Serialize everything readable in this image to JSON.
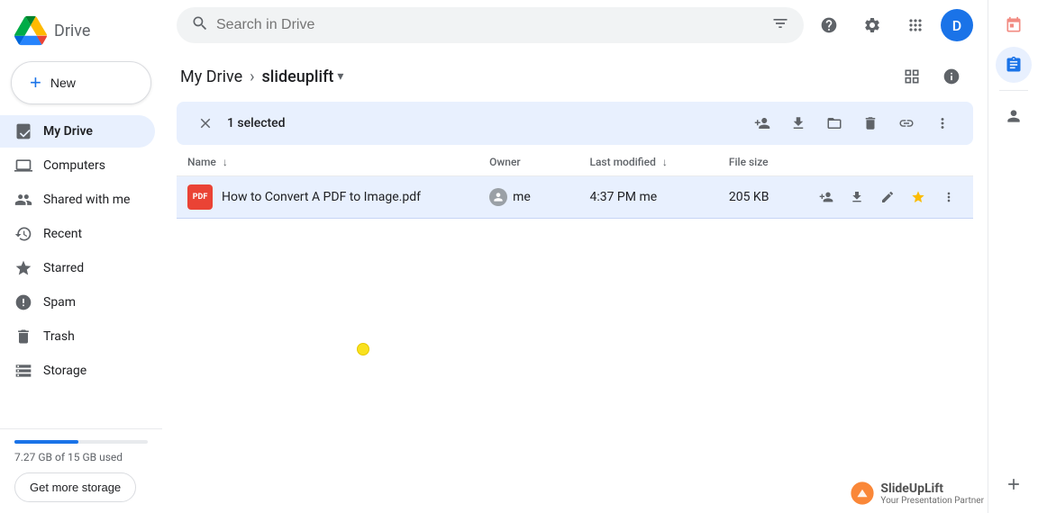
{
  "app": {
    "title": "Drive",
    "logo_text": "Drive"
  },
  "sidebar": {
    "new_button_label": "New",
    "nav_items": [
      {
        "id": "my-drive",
        "label": "My Drive",
        "icon": "🏠",
        "active": true
      },
      {
        "id": "computers",
        "label": "Computers",
        "icon": "💻",
        "active": false
      },
      {
        "id": "shared",
        "label": "Shared with me",
        "icon": "👥",
        "active": false
      },
      {
        "id": "recent",
        "label": "Recent",
        "icon": "🕐",
        "active": false
      },
      {
        "id": "starred",
        "label": "Starred",
        "icon": "⭐",
        "active": false
      },
      {
        "id": "spam",
        "label": "Spam",
        "icon": "⚠️",
        "active": false
      },
      {
        "id": "trash",
        "label": "Trash",
        "icon": "🗑️",
        "active": false
      },
      {
        "id": "storage",
        "label": "Storage",
        "icon": "☁️",
        "active": false
      }
    ],
    "storage": {
      "used_text": "7.27 GB of 15 GB used",
      "used_pct": 48,
      "get_more_label": "Get more storage"
    }
  },
  "topbar": {
    "search_placeholder": "Search in Drive",
    "filter_icon": "filter",
    "help_icon": "help",
    "settings_icon": "settings",
    "apps_icon": "apps",
    "avatar_letter": "D"
  },
  "breadcrumb": {
    "root": "My Drive",
    "sep": "›",
    "current": "slideuplift",
    "dropdown_icon": "▾"
  },
  "action_bar": {
    "close_icon": "✕",
    "selected_text": "1 selected",
    "icons": [
      {
        "id": "add-person",
        "label": "Share",
        "icon": "person-add",
        "unicode": "👤+"
      },
      {
        "id": "download",
        "label": "Download",
        "icon": "download",
        "unicode": "⬇"
      },
      {
        "id": "move-to-folder",
        "label": "Move to",
        "icon": "folder",
        "unicode": "📁"
      },
      {
        "id": "delete",
        "label": "Delete",
        "icon": "trash",
        "unicode": "🗑"
      },
      {
        "id": "get-link",
        "label": "Get link",
        "icon": "link",
        "unicode": "🔗"
      },
      {
        "id": "more",
        "label": "More actions",
        "icon": "more-vert",
        "unicode": "⋮"
      }
    ]
  },
  "file_table": {
    "columns": [
      {
        "id": "name",
        "label": "Name",
        "sortable": true,
        "sort_active": true,
        "sort_dir": "asc"
      },
      {
        "id": "owner",
        "label": "Owner",
        "sortable": false
      },
      {
        "id": "modified",
        "label": "Last modified",
        "sortable": true
      },
      {
        "id": "size",
        "label": "File size",
        "sortable": false
      }
    ],
    "rows": [
      {
        "id": "file-1",
        "name": "How to Convert A PDF to Image.pdf",
        "type": "pdf",
        "owner": "me",
        "modified": "4:37 PM  me",
        "size": "205 KB",
        "starred": true
      }
    ]
  },
  "view_toggle": {
    "grid_icon": "grid",
    "info_icon": "info"
  },
  "right_panel": {
    "icons": [
      {
        "id": "calendar",
        "label": "Calendar",
        "unicode": "📅",
        "active": false
      },
      {
        "id": "tasks",
        "label": "Tasks",
        "unicode": "✓",
        "active": true
      },
      {
        "id": "contacts",
        "label": "Contacts",
        "unicode": "👤",
        "active": false
      }
    ],
    "add_icon": "+"
  },
  "watermark": {
    "brand": "SlideUpLift",
    "sub": "Your Presentation Partner"
  }
}
